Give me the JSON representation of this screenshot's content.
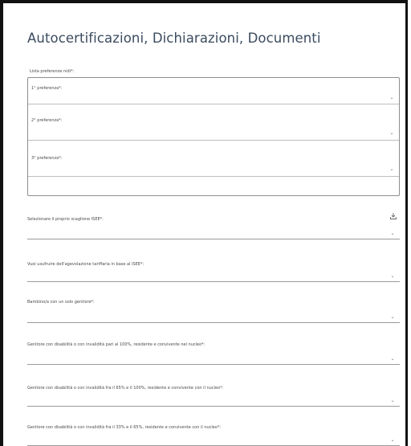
{
  "page": {
    "title": "Autocertificazioni, Dichiarazioni, Documenti"
  },
  "preferences": {
    "label": "Lista preferenze nidi*:",
    "items": [
      {
        "label": "1° preferenza*:"
      },
      {
        "label": "2° preferenza*:"
      },
      {
        "label": "3° preferenza*:"
      }
    ]
  },
  "fields": [
    {
      "label": "Selezionare il proprio scaglione ISEE*:",
      "value": ""
    },
    {
      "label": "Vuoi usufruire dell'agevolazione tariffaria in base al ISEE*:",
      "value": ""
    },
    {
      "label": "Bambino/a con un solo genitore*:",
      "value": ""
    },
    {
      "label": "Genitore con disabilità o con invalidità pari al 100%, residente e convivente nel nucleo*:",
      "value": ""
    },
    {
      "label": "Genitore con disabilità o con invalidità fra il 65% e il 100%, residente e convivente con il nucleo*:",
      "value": ""
    },
    {
      "label": "Genitore con disabilità o con invalidità fra il 33% e il 65%, residente e convivente con il nucleo*:",
      "value": ""
    }
  ],
  "icons": {
    "select": "chevron-down-icon",
    "download": "download-icon"
  },
  "colors": {
    "title": "#3b4b5f",
    "border": "#8e8e8e",
    "text": "#4a4a4a"
  }
}
